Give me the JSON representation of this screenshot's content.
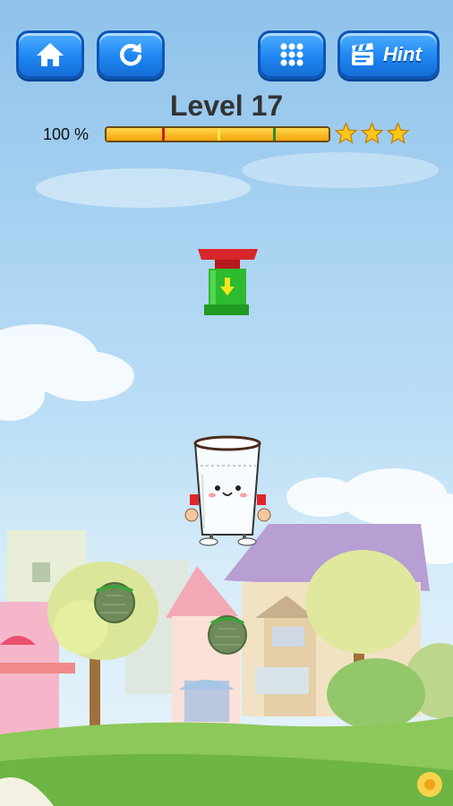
{
  "toolbar": {
    "home_icon": "home-icon",
    "restart_icon": "restart-icon",
    "levels_icon": "grid-icon",
    "hint_icon": "film-clapper-icon",
    "hint_label": "Hint"
  },
  "hud": {
    "level_title": "Level 17",
    "progress_text": "100 %",
    "progress_fraction": 1.0,
    "star_thresholds": [
      0.25,
      0.5,
      0.75
    ],
    "threshold_colors": [
      "#c81e1e",
      "#f6e84a",
      "#2d8a3a"
    ],
    "stars_earned": 3,
    "stars_total": 3
  },
  "colors": {
    "button_blue": "#1e86f2",
    "bar_fill": "#f2a40e",
    "star": "#ffc61a"
  },
  "scene": {
    "dispenser": "water-dispenser",
    "glass_character": "smiling-glass",
    "obstacles": [
      "green-moss-ball",
      "green-moss-ball"
    ]
  }
}
